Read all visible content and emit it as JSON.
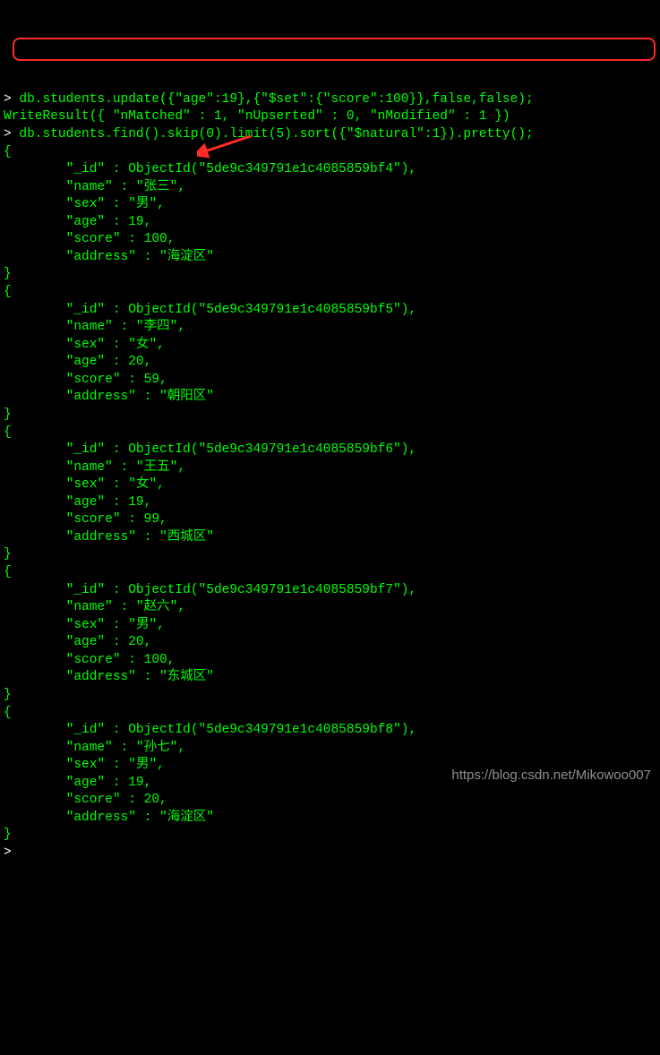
{
  "prompt_char": ">",
  "commands": {
    "update": "db.students.update({\"age\":19},{\"$set\":{\"score\":100}},false,false);",
    "update_result": "WriteResult({ \"nMatched\" : 1, \"nUpserted\" : 0, \"nModified\" : 1 })",
    "find": "db.students.find().skip(0).limit(5).sort({\"$natural\":1}).pretty();"
  },
  "docs": [
    {
      "_id": "5de9c349791e1c4085859bf4",
      "name": "张三",
      "sex": "男",
      "age": 19,
      "score": 100,
      "address": "海淀区"
    },
    {
      "_id": "5de9c349791e1c4085859bf5",
      "name": "李四",
      "sex": "女",
      "age": 20,
      "score": 59,
      "address": "朝阳区"
    },
    {
      "_id": "5de9c349791e1c4085859bf6",
      "name": "王五",
      "sex": "女",
      "age": 19,
      "score": 99,
      "address": "西城区"
    },
    {
      "_id": "5de9c349791e1c4085859bf7",
      "name": "赵六",
      "sex": "男",
      "age": 20,
      "score": 100,
      "address": "东城区"
    },
    {
      "_id": "5de9c349791e1c4085859bf8",
      "name": "孙七",
      "sex": "男",
      "age": 19,
      "score": 20,
      "address": "海淀区"
    }
  ],
  "watermark": "https://blog.csdn.net/Mikowoo007",
  "highlight_color": "#ff2a2a",
  "arrow_color": "#ff2a2a"
}
